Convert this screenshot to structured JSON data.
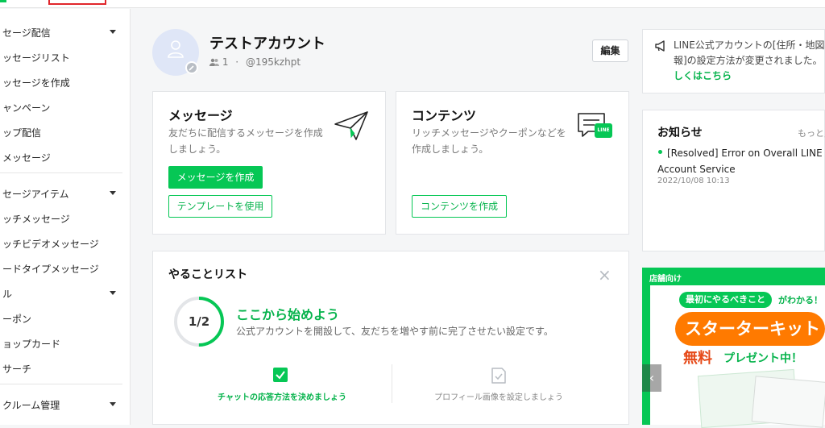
{
  "sidebar": {
    "groups": [
      {
        "label": "セージ配信",
        "items": [
          "ッセージリスト",
          "ッセージを作成",
          "ャンペーン",
          "ップ配信",
          "メッセージ"
        ]
      },
      {
        "label": "セージアイテム",
        "items": [
          "ッチメッセージ",
          "ッチビデオメッセージ",
          "ードタイプメッセージ"
        ]
      },
      {
        "label": "ル",
        "items": [
          "ーポン",
          "ョップカード",
          "サーチ"
        ]
      },
      {
        "label": "クルーム管理",
        "items": []
      }
    ]
  },
  "account": {
    "name": "テストアカウント",
    "followers": "1",
    "separator": "·",
    "id": "@195kzhpt",
    "edit_label": "編集"
  },
  "message_card": {
    "title": "メッセージ",
    "desc_line1": "友だちに配信するメッセージを作成",
    "desc_line2": "しましょう。",
    "primary_label": "メッセージを作成",
    "secondary_label": "テンプレートを使用"
  },
  "content_card": {
    "title": "コンテンツ",
    "desc_line1": "リッチメッセージやクーポンなどを",
    "desc_line2": "作成しましょう。",
    "button_label": "コンテンツを作成",
    "icon_text": "LINE"
  },
  "notice": {
    "line1": "LINE公式アカウントの[住所・地図",
    "line2": "報]の設定方法が変更されました。",
    "link": "しくはこちら"
  },
  "news": {
    "title": "お知らせ",
    "more": "もっと見",
    "item_line1": "[Resolved] Error on Overall LINE Offic",
    "item_line2": "Account Service",
    "item_date": "2022/10/08 10:13"
  },
  "todo": {
    "title": "やることリスト",
    "close": "×",
    "progress_label": "1/2",
    "progress": 0.5,
    "heading": "ここから始めよう",
    "description": "公式アカウントを開設して、友だちを増やす前に完了させたい設定です。",
    "tasks": [
      {
        "label": "チャットの応答方法を決めましょう",
        "done": true
      },
      {
        "label": "プロフィール画像を設定しましょう",
        "done": false
      }
    ]
  },
  "promo": {
    "tag": "店舗向け",
    "pill": "最初にやるべきこと",
    "pill_after": "がわかる！",
    "headline": "スターターキット",
    "free": "無料",
    "free_after": "プレゼント中！",
    "prev": "‹"
  },
  "colors": {
    "brand_green": "#06c755",
    "orange": "#ff7a00"
  }
}
